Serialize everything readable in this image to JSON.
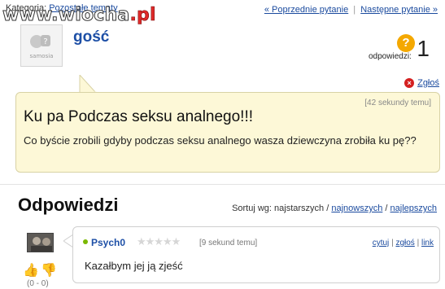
{
  "header": {
    "category_label": "Kategoria:",
    "category_link": "Pozostałe tematy",
    "watermark_main": "www.wiocha",
    "watermark_tld": ".pl",
    "nav_prev": "« Poprzednie pytanie",
    "nav_sep": "|",
    "nav_next": "Następne pytanie »"
  },
  "asker": {
    "avatar_text": "samosia",
    "name": "gość"
  },
  "stats": {
    "answers_label": "odpowiedzi:",
    "answers_count": "1",
    "question_icon": "?"
  },
  "report": {
    "label": "Zgłoś",
    "icon": "x-circle-icon"
  },
  "question": {
    "time": "[42 sekundy temu]",
    "title": "Ku pa Podczas seksu analnego!!!",
    "body": "Co byście zrobili gdyby podczas seksu analnego wasza dziewczyna zrobiła ku pę??"
  },
  "answers_section": {
    "title": "Odpowiedzi",
    "sort_label": "Sortuj wg: najstarszych /",
    "sort_newest": "najnowszych",
    "sort_sep": "/",
    "sort_best": "najlepszych"
  },
  "answer": {
    "user": "Psych0",
    "stars": "★★★★★",
    "time": "[9 sekund temu]",
    "action_quote": "cytuj",
    "action_report": "zgłoś",
    "action_link": "link",
    "sep": "|",
    "text": "Kazałbym jej ją zjeść",
    "votes": "(0 - 0)"
  },
  "colors": {
    "link": "#1a4a9e",
    "bubble_bg": "#fdf8d7",
    "accent_orange": "#f4a800",
    "report_red": "#d42020",
    "online_green": "#7ab800"
  }
}
